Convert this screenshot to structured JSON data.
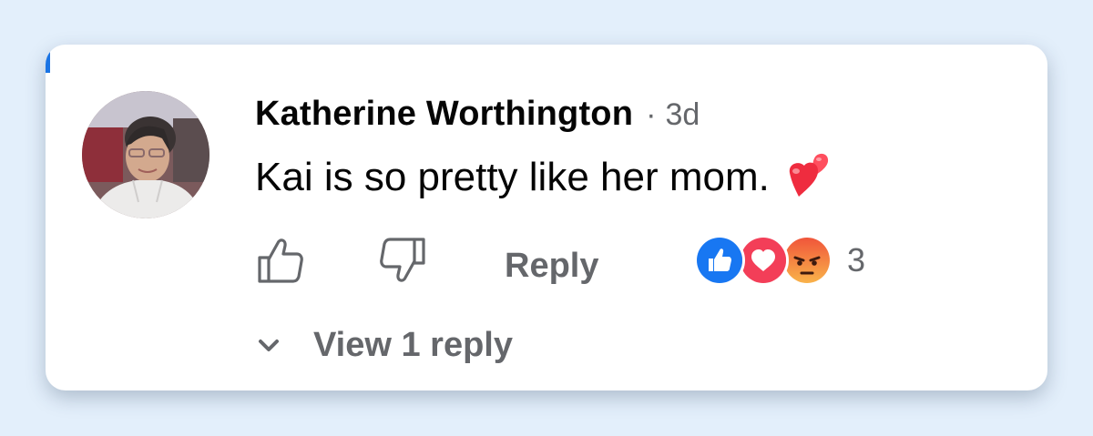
{
  "comment": {
    "author": "Katherine Worthington",
    "separator": "·",
    "time": "3d",
    "text": "Kai is so pretty like her mom.",
    "emoji": "two-hearts-emoji"
  },
  "actions": {
    "like_icon": "thumbs-up-icon",
    "dislike_icon": "thumbs-down-icon",
    "reply_label": "Reply"
  },
  "reactions": {
    "icons": [
      "like-reaction-icon",
      "love-reaction-icon",
      "angry-reaction-icon"
    ],
    "count": "3",
    "colors": {
      "like": "#1877f2",
      "love": "#f33e58",
      "angry": "#f7714b"
    }
  },
  "replies": {
    "label": "View 1 reply",
    "icon": "chevron-down-icon"
  },
  "colors": {
    "background": "#e3effb",
    "accent": "#1b74e4",
    "secondary_text": "#65676b",
    "primary_text": "#050505"
  }
}
